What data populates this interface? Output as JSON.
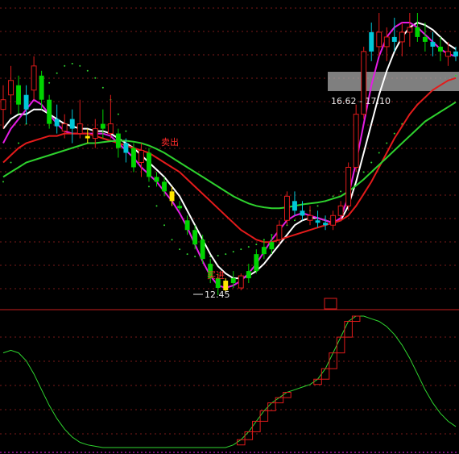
{
  "colors": {
    "background": "#000000",
    "grid": "#7a1a1a",
    "divider": "#c81e1e",
    "up_candle": "#e01b1b",
    "down_candle": "#00d400",
    "cyan_candle": "#00c8d8",
    "yellow_candle": "#ffe600",
    "ma_white": "#ffffff",
    "ma_magenta": "#e41ce4",
    "ma_red": "#e41b1b",
    "ma_green": "#2ed12e",
    "dots": "#2fd52f",
    "osc_line": "#2fd52f",
    "osc_box": "#e01b1b",
    "price_label": "#e8e8e8",
    "signal_text": "#ff2a2a",
    "band": "#aaaaaa"
  },
  "chart_data": [
    {
      "type": "candlestick",
      "panel": "main",
      "grid": true,
      "annotations": {
        "low_label": "12.45",
        "band_label": "16.62 - 17.10",
        "buy_signal": "买进",
        "sell_signal": "卖出"
      },
      "candles": [
        {
          "o": 16.3,
          "h": 16.8,
          "l": 15.9,
          "c": 16.5,
          "k": "up"
        },
        {
          "o": 16.6,
          "h": 17.2,
          "l": 16.2,
          "c": 16.9,
          "k": "up"
        },
        {
          "o": 16.8,
          "h": 17.0,
          "l": 16.2,
          "c": 16.4,
          "k": "down"
        },
        {
          "o": 16.3,
          "h": 16.8,
          "l": 16.0,
          "c": 16.6,
          "k": "cyan"
        },
        {
          "o": 16.7,
          "h": 17.4,
          "l": 16.5,
          "c": 17.2,
          "k": "up"
        },
        {
          "o": 17.0,
          "h": 17.1,
          "l": 16.3,
          "c": 16.5,
          "k": "down"
        },
        {
          "o": 16.5,
          "h": 16.6,
          "l": 15.9,
          "c": 16.0,
          "k": "down"
        },
        {
          "o": 16.1,
          "h": 16.4,
          "l": 15.8,
          "c": 15.95,
          "k": "cyan"
        },
        {
          "o": 16.0,
          "h": 16.2,
          "l": 15.7,
          "c": 15.85,
          "k": "up"
        },
        {
          "o": 15.9,
          "h": 16.3,
          "l": 15.6,
          "c": 16.1,
          "k": "cyan"
        },
        {
          "o": 16.0,
          "h": 16.5,
          "l": 15.7,
          "c": 15.8,
          "k": "up"
        },
        {
          "o": 15.75,
          "h": 15.9,
          "l": 15.6,
          "c": 15.7,
          "k": "yellow"
        },
        {
          "o": 15.7,
          "h": 16.1,
          "l": 15.5,
          "c": 15.9,
          "k": "up"
        },
        {
          "o": 15.9,
          "h": 16.3,
          "l": 15.7,
          "c": 16.0,
          "k": "down"
        },
        {
          "o": 16.0,
          "h": 16.6,
          "l": 15.7,
          "c": 15.8,
          "k": "up"
        },
        {
          "o": 15.8,
          "h": 15.9,
          "l": 15.3,
          "c": 15.5,
          "k": "down"
        },
        {
          "o": 15.4,
          "h": 15.7,
          "l": 15.2,
          "c": 15.6,
          "k": "cyan"
        },
        {
          "o": 15.5,
          "h": 15.6,
          "l": 15.0,
          "c": 15.1,
          "k": "down"
        },
        {
          "o": 15.2,
          "h": 15.6,
          "l": 14.9,
          "c": 15.45,
          "k": "up"
        },
        {
          "o": 15.4,
          "h": 15.5,
          "l": 14.8,
          "c": 14.9,
          "k": "down"
        },
        {
          "o": 14.9,
          "h": 15.0,
          "l": 14.7,
          "c": 14.8,
          "k": "down"
        },
        {
          "o": 14.8,
          "h": 14.9,
          "l": 14.5,
          "c": 14.6,
          "k": "down"
        },
        {
          "o": 14.6,
          "h": 14.7,
          "l": 14.3,
          "c": 14.4,
          "k": "yellow"
        },
        {
          "o": 14.3,
          "h": 14.4,
          "l": 14.2,
          "c": 14.25,
          "k": "down"
        },
        {
          "o": 14.0,
          "h": 14.1,
          "l": 13.7,
          "c": 13.8,
          "k": "down"
        },
        {
          "o": 13.8,
          "h": 13.9,
          "l": 13.4,
          "c": 13.5,
          "k": "down"
        },
        {
          "o": 13.6,
          "h": 13.7,
          "l": 13.1,
          "c": 13.2,
          "k": "down"
        },
        {
          "o": 13.1,
          "h": 13.2,
          "l": 12.7,
          "c": 12.8,
          "k": "down"
        },
        {
          "o": 12.8,
          "h": 12.9,
          "l": 12.45,
          "c": 12.6,
          "k": "down"
        },
        {
          "o": 12.55,
          "h": 12.8,
          "l": 12.5,
          "c": 12.75,
          "k": "yellow"
        },
        {
          "o": 12.8,
          "h": 12.95,
          "l": 12.6,
          "c": 12.7,
          "k": "down"
        },
        {
          "o": 12.6,
          "h": 12.9,
          "l": 12.55,
          "c": 12.85,
          "k": "up"
        },
        {
          "o": 12.8,
          "h": 13.1,
          "l": 12.7,
          "c": 12.95,
          "k": "down"
        },
        {
          "o": 12.95,
          "h": 13.4,
          "l": 12.9,
          "c": 13.3,
          "k": "down"
        },
        {
          "o": 13.3,
          "h": 13.6,
          "l": 13.2,
          "c": 13.45,
          "k": "down"
        },
        {
          "o": 13.4,
          "h": 13.7,
          "l": 13.3,
          "c": 13.55,
          "k": "down"
        },
        {
          "o": 13.6,
          "h": 14.0,
          "l": 13.5,
          "c": 13.9,
          "k": "up"
        },
        {
          "o": 14.0,
          "h": 14.6,
          "l": 13.9,
          "c": 14.5,
          "k": "up"
        },
        {
          "o": 14.4,
          "h": 14.6,
          "l": 14.1,
          "c": 14.2,
          "k": "cyan"
        },
        {
          "o": 14.2,
          "h": 14.4,
          "l": 14.0,
          "c": 14.1,
          "k": "cyan"
        },
        {
          "o": 14.1,
          "h": 14.3,
          "l": 13.9,
          "c": 14.0,
          "k": "up"
        },
        {
          "o": 14.0,
          "h": 14.2,
          "l": 13.85,
          "c": 13.95,
          "k": "cyan"
        },
        {
          "o": 13.95,
          "h": 14.1,
          "l": 13.8,
          "c": 13.9,
          "k": "cyan"
        },
        {
          "o": 13.9,
          "h": 14.2,
          "l": 13.8,
          "c": 14.1,
          "k": "up"
        },
        {
          "o": 14.1,
          "h": 14.4,
          "l": 14.0,
          "c": 14.3,
          "k": "up"
        },
        {
          "o": 14.3,
          "h": 15.2,
          "l": 14.2,
          "c": 15.1,
          "k": "up"
        },
        {
          "o": 15.1,
          "h": 16.4,
          "l": 15.0,
          "c": 16.2,
          "k": "up"
        },
        {
          "o": 16.2,
          "h": 17.6,
          "l": 16.1,
          "c": 17.5,
          "k": "up"
        },
        {
          "o": 17.5,
          "h": 18.1,
          "l": 17.3,
          "c": 17.9,
          "k": "cyan"
        },
        {
          "o": 17.9,
          "h": 18.3,
          "l": 17.4,
          "c": 17.6,
          "k": "up"
        },
        {
          "o": 17.6,
          "h": 18.0,
          "l": 17.3,
          "c": 17.8,
          "k": "up"
        },
        {
          "o": 17.8,
          "h": 18.2,
          "l": 17.5,
          "c": 17.7,
          "k": "cyan"
        },
        {
          "o": 17.7,
          "h": 18.1,
          "l": 17.4,
          "c": 17.9,
          "k": "up"
        },
        {
          "o": 17.9,
          "h": 18.3,
          "l": 17.6,
          "c": 18.0,
          "k": "up"
        },
        {
          "o": 18.0,
          "h": 18.3,
          "l": 17.7,
          "c": 17.8,
          "k": "down"
        },
        {
          "o": 17.8,
          "h": 18.1,
          "l": 17.5,
          "c": 17.7,
          "k": "down"
        },
        {
          "o": 17.7,
          "h": 17.9,
          "l": 17.4,
          "c": 17.6,
          "k": "cyan"
        },
        {
          "o": 17.6,
          "h": 17.8,
          "l": 17.3,
          "c": 17.5,
          "k": "down"
        },
        {
          "o": 17.5,
          "h": 17.7,
          "l": 17.2,
          "c": 17.4,
          "k": "up"
        },
        {
          "o": 17.4,
          "h": 17.6,
          "l": 17.3,
          "c": 17.5,
          "k": "cyan"
        }
      ],
      "series": [
        {
          "color_key": "ma_white",
          "values": [
            15.9,
            16.1,
            16.2,
            16.2,
            16.3,
            16.3,
            16.2,
            16.1,
            16.0,
            15.95,
            15.9,
            15.9,
            15.85,
            15.85,
            15.8,
            15.7,
            15.6,
            15.5,
            15.35,
            15.2,
            15.05,
            14.9,
            14.7,
            14.5,
            14.2,
            13.9,
            13.6,
            13.3,
            13.05,
            12.9,
            12.8,
            12.8,
            12.85,
            12.95,
            13.1,
            13.3,
            13.5,
            13.7,
            13.9,
            14.0,
            14.05,
            14.05,
            14.0,
            13.95,
            14.0,
            14.3,
            14.8,
            15.4,
            16.0,
            16.6,
            17.1,
            17.5,
            17.8,
            18.0,
            18.1,
            18.05,
            17.95,
            17.8,
            17.65,
            17.55
          ]
        },
        {
          "color_key": "ma_magenta",
          "values": [
            15.6,
            15.9,
            16.1,
            16.3,
            16.5,
            16.4,
            16.2,
            16.0,
            15.85,
            15.8,
            15.8,
            15.8,
            15.8,
            15.8,
            15.75,
            15.6,
            15.45,
            15.3,
            15.1,
            14.95,
            14.8,
            14.6,
            14.4,
            14.15,
            13.85,
            13.5,
            13.15,
            12.85,
            12.65,
            12.6,
            12.65,
            12.75,
            12.9,
            13.1,
            13.35,
            13.6,
            13.8,
            14.0,
            14.1,
            14.15,
            14.1,
            14.05,
            14.0,
            13.95,
            14.05,
            14.5,
            15.2,
            16.0,
            16.8,
            17.4,
            17.8,
            18.0,
            18.1,
            18.1,
            18.0,
            17.85,
            17.7,
            17.55,
            17.45,
            17.4
          ]
        },
        {
          "color_key": "ma_red",
          "values": [
            15.2,
            15.35,
            15.5,
            15.6,
            15.65,
            15.7,
            15.75,
            15.75,
            15.8,
            15.8,
            15.8,
            15.8,
            15.75,
            15.7,
            15.65,
            15.6,
            15.55,
            15.5,
            15.45,
            15.4,
            15.3,
            15.2,
            15.1,
            15.0,
            14.85,
            14.7,
            14.55,
            14.4,
            14.25,
            14.1,
            13.95,
            13.8,
            13.7,
            13.6,
            13.55,
            13.55,
            13.6,
            13.65,
            13.7,
            13.75,
            13.8,
            13.85,
            13.9,
            13.95,
            14.0,
            14.1,
            14.3,
            14.55,
            14.8,
            15.1,
            15.4,
            15.7,
            15.95,
            16.2,
            16.4,
            16.55,
            16.7,
            16.8,
            16.9,
            16.95
          ]
        },
        {
          "color_key": "ma_green",
          "values": [
            14.9,
            15.0,
            15.1,
            15.2,
            15.25,
            15.3,
            15.35,
            15.4,
            15.45,
            15.5,
            15.55,
            15.6,
            15.6,
            15.62,
            15.64,
            15.65,
            15.65,
            15.63,
            15.6,
            15.55,
            15.48,
            15.4,
            15.3,
            15.2,
            15.1,
            15.0,
            14.9,
            14.8,
            14.7,
            14.6,
            14.5,
            14.42,
            14.35,
            14.3,
            14.27,
            14.25,
            14.25,
            14.27,
            14.3,
            14.33,
            14.35,
            14.37,
            14.4,
            14.45,
            14.5,
            14.6,
            14.72,
            14.85,
            15.0,
            15.15,
            15.3,
            15.45,
            15.6,
            15.75,
            15.9,
            16.05,
            16.15,
            16.25,
            16.35,
            16.45
          ]
        },
        {
          "color_key": "dots",
          "values": [
            14.8,
            15.2,
            15.6,
            16.0,
            16.3,
            16.6,
            16.85,
            17.05,
            17.2,
            17.25,
            17.2,
            17.1,
            16.95,
            16.75,
            16.5,
            16.2,
            15.85,
            15.5,
            15.1,
            14.7,
            14.3,
            13.9,
            13.6,
            13.4,
            13.3,
            13.25,
            13.25,
            13.25,
            13.27,
            13.3,
            13.35,
            13.4,
            13.45,
            13.5,
            13.6,
            13.7,
            13.8,
            13.9,
            14.0,
            14.1,
            14.2,
            14.3,
            14.4,
            14.5,
            14.6,
            14.7,
            14.8,
            15.0,
            15.2,
            15.4,
            15.6,
            15.8,
            16.0,
            16.2,
            16.4,
            16.55,
            16.7,
            16.8,
            16.9,
            17.0
          ]
        }
      ]
    },
    {
      "type": "line",
      "panel": "oscillator",
      "grid": true,
      "ylim": [
        0,
        100
      ],
      "series": [
        {
          "color_key": "osc_line",
          "values": [
            72,
            74,
            72,
            66,
            56,
            44,
            32,
            22,
            14,
            8,
            4,
            2,
            1,
            0,
            0,
            0,
            0,
            0,
            0,
            0,
            0,
            0,
            0,
            0,
            0,
            0,
            0,
            0,
            0,
            0,
            2,
            6,
            12,
            20,
            28,
            34,
            38,
            42,
            44,
            46,
            48,
            52,
            60,
            72,
            84,
            96,
            100,
            100,
            98,
            96,
            92,
            86,
            78,
            68,
            56,
            44,
            34,
            26,
            20,
            16
          ]
        }
      ]
    }
  ]
}
